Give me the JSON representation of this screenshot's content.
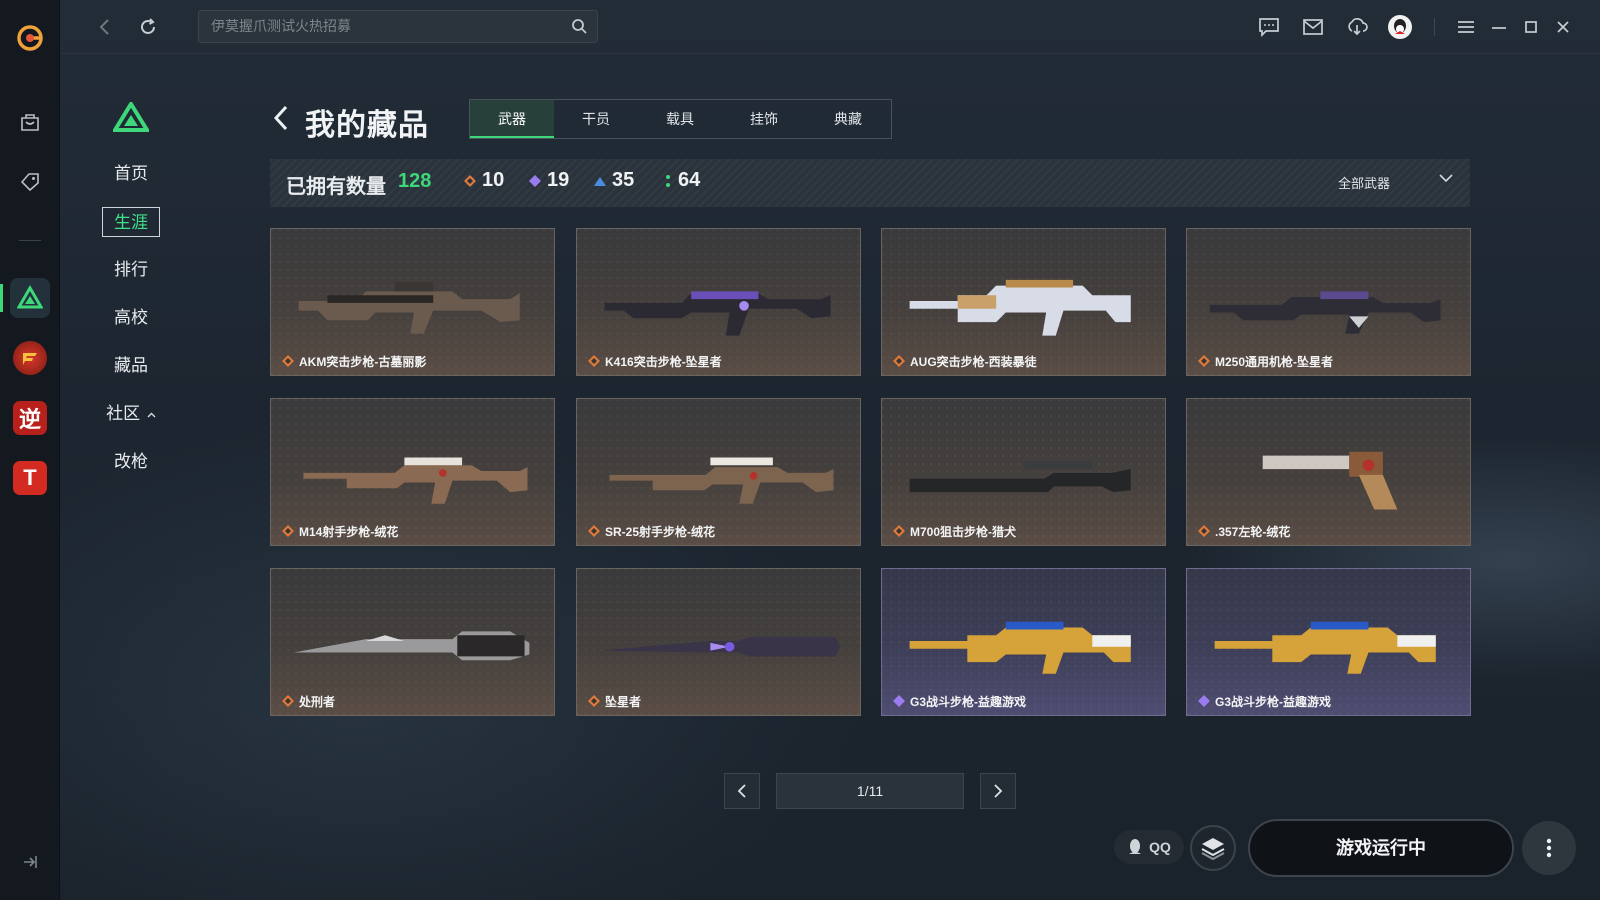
{
  "search": {
    "placeholder": "伊莫握爪测试火热招募"
  },
  "menu": {
    "items": [
      {
        "label": "首页"
      },
      {
        "label": "生涯"
      },
      {
        "label": "排行"
      },
      {
        "label": "高校"
      },
      {
        "label": "藏品"
      },
      {
        "label": "社区"
      },
      {
        "label": "改枪"
      }
    ]
  },
  "rail": {
    "games": [
      "逆",
      "T"
    ]
  },
  "header": {
    "title": "我的藏品",
    "tabs": [
      "武器",
      "干员",
      "载具",
      "挂饰",
      "典藏"
    ]
  },
  "stats": {
    "owned_label": "已拥有数量",
    "owned_count": "128",
    "tier_counts": [
      "10",
      "19",
      "35",
      "64"
    ],
    "filter_label": "全部武器"
  },
  "items": [
    {
      "name": "AKM突击步枪-古墓丽影",
      "tier": "orange"
    },
    {
      "name": "K416突击步枪-坠星者",
      "tier": "orange"
    },
    {
      "name": "AUG突击步枪-西装暴徒",
      "tier": "orange"
    },
    {
      "name": "M250通用机枪-坠星者",
      "tier": "orange"
    },
    {
      "name": "M14射手步枪-绒花",
      "tier": "orange"
    },
    {
      "name": "SR-25射手步枪-绒花",
      "tier": "orange"
    },
    {
      "name": "M700狙击步枪-猎犬",
      "tier": "orange"
    },
    {
      "name": ".357左轮-绒花",
      "tier": "orange"
    },
    {
      "name": "处刑者",
      "tier": "orange"
    },
    {
      "name": "坠星者",
      "tier": "orange"
    },
    {
      "name": "G3战斗步枪-益趣游戏",
      "tier": "purple"
    },
    {
      "name": "G3战斗步枪-益趣游戏",
      "tier": "purple"
    }
  ],
  "pagination": {
    "text": "1/11"
  },
  "footer": {
    "qq_label": "QQ",
    "launch_label": "游戏运行中"
  },
  "colors": {
    "accent": "#3ed77a",
    "orange_tier": "#e07a3a",
    "purple_tier": "#9b7cf0",
    "blue_tier": "#4a8de0",
    "green_tier": "#3ed77a"
  }
}
